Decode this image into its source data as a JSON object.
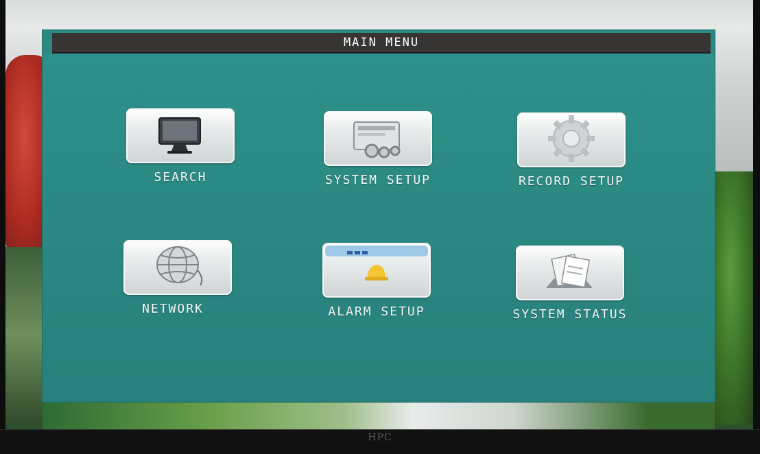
{
  "window": {
    "title": "MAIN MENU"
  },
  "menu": {
    "items": [
      {
        "id": "search",
        "label": "SEARCH",
        "icon": "monitor-icon"
      },
      {
        "id": "system-setup",
        "label": "SYSTEM SETUP",
        "icon": "settings-gears-icon"
      },
      {
        "id": "record-setup",
        "label": "RECORD SETUP",
        "icon": "gear-icon"
      },
      {
        "id": "network",
        "label": "NETWORK",
        "icon": "globe-icon"
      },
      {
        "id": "alarm-setup",
        "label": "ALARM SETUP",
        "icon": "alarm-bell-window-icon"
      },
      {
        "id": "system-status",
        "label": "SYSTEM STATUS",
        "icon": "documents-status-icon"
      }
    ]
  },
  "monitor": {
    "brand": "HPC"
  },
  "colors": {
    "menu_background": "#2b8883",
    "title_bar": "#373533",
    "text": "#ffffff"
  }
}
